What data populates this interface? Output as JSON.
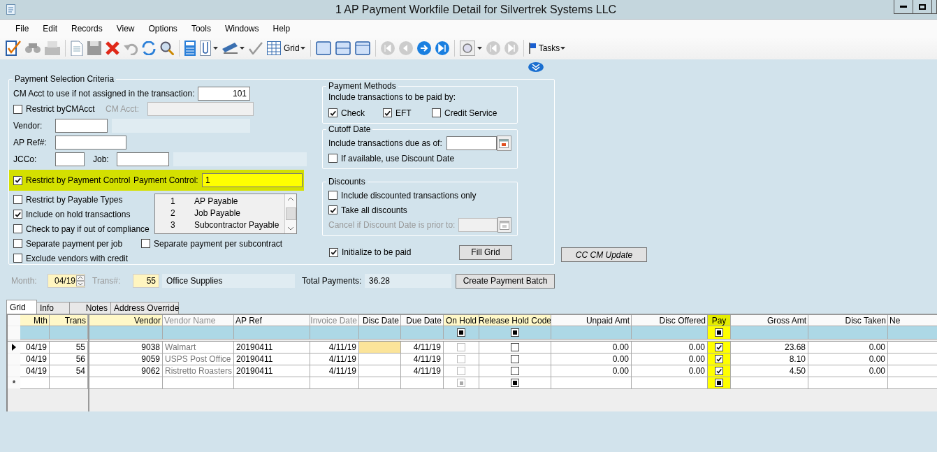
{
  "window": {
    "title": "1 AP Payment Workfile Detail for Silvertrek Systems LLC"
  },
  "menu": [
    "File",
    "Edit",
    "Records",
    "View",
    "Options",
    "Tools",
    "Windows",
    "Help"
  ],
  "toolbar": {
    "grid_label": "Grid",
    "tasks_label": "Tasks"
  },
  "selection_criteria": {
    "title": "Payment Selection Criteria",
    "cm_acct_label": "CM Acct to use if not assigned in the transaction:",
    "cm_acct_value": "101",
    "restrict_cmacct": {
      "label": "Restrict byCMAcct",
      "checked": false
    },
    "cm_acct_field_label": "CM Acct:",
    "vendor_label": "Vendor:",
    "ap_ref_label": "AP Ref#:",
    "jcco_label": "JCCo:",
    "job_label": "Job:",
    "restrict_payment_control": {
      "label": "Restrict by Payment Control",
      "checked": true,
      "highlighted": true
    },
    "payment_control_label": "Payment Control:",
    "payment_control_value": "1",
    "options": [
      {
        "label": "Restrict by Payable Types",
        "checked": false
      },
      {
        "label": "Include on hold transactions",
        "checked": true
      },
      {
        "label": "Check to pay if out of compliance",
        "checked": false
      },
      {
        "label": "Separate payment per job",
        "checked": false
      },
      {
        "label": "Exclude vendors with credit",
        "checked": false
      }
    ],
    "subcontract_option": {
      "label": "Separate payment per subcontract",
      "checked": false
    },
    "payable_types": [
      {
        "number": "1",
        "name": "AP Payable"
      },
      {
        "number": "2",
        "name": "Job Payable"
      },
      {
        "number": "3",
        "name": "Subcontractor Payable"
      }
    ],
    "payment_methods": {
      "title": "Payment Methods",
      "prompt": "Include transactions to be paid by:",
      "methods": [
        {
          "label": "Check",
          "checked": true
        },
        {
          "label": "EFT",
          "checked": true
        },
        {
          "label": "Credit Service",
          "checked": false
        }
      ]
    },
    "cutoff_date": {
      "title": "Cutoff Date",
      "due_label": "Include transactions due as of:",
      "use_discount_date": {
        "label": "If available, use Discount Date",
        "checked": false
      }
    },
    "discounts": {
      "title": "Discounts",
      "options": [
        {
          "label": "Include discounted transactions only",
          "checked": false
        },
        {
          "label": "Take all discounts",
          "checked": true
        }
      ],
      "cancel_label": "Cancel if Discount Date is prior to:"
    },
    "initialize_to_be_paid": {
      "label": "Initialize to be paid",
      "checked": true
    },
    "fill_grid_button": "Fill Grid"
  },
  "cc_cm_update_button": "CC CM Update",
  "batch": {
    "month_label": "Month:",
    "month_value": "04/19",
    "trans_label": "Trans#:",
    "trans_value": "55",
    "description": "Office Supplies",
    "total_label": "Total Payments:",
    "total_value": "36.28",
    "create_button": "Create Payment Batch"
  },
  "tabs": [
    {
      "label": "Grid",
      "selected": true
    },
    {
      "label": "Info",
      "selected": false
    },
    {
      "label": "Notes",
      "selected": false
    },
    {
      "label": "Address Override",
      "selected": false
    }
  ],
  "grid": {
    "frozen_columns": [
      {
        "label": "Mth",
        "kind": "key"
      },
      {
        "label": "Trans",
        "kind": "key"
      }
    ],
    "columns": [
      {
        "label": "Vendor",
        "kind": "key"
      },
      {
        "label": "Vendor Name",
        "kind": "readonly_text"
      },
      {
        "label": "AP Ref",
        "kind": "text"
      },
      {
        "label": "Invoice Date",
        "kind": "readonly_number"
      },
      {
        "label": "Disc Date",
        "kind": "number"
      },
      {
        "label": "Due Date",
        "kind": "number"
      },
      {
        "label": "On Hold",
        "kind": "key_check"
      },
      {
        "label": "Release Hold Code",
        "kind": "key_check"
      },
      {
        "label": "Unpaid Amt",
        "kind": "number"
      },
      {
        "label": "Disc Offered",
        "kind": "number"
      },
      {
        "label": "Pay",
        "kind": "check",
        "highlighted": true
      },
      {
        "label": "Gross Amt",
        "kind": "number"
      },
      {
        "label": "Disc Taken",
        "kind": "number"
      },
      {
        "label": "Ne",
        "kind": "text"
      }
    ],
    "filter_row": {
      "on_hold": {
        "mixed": true
      },
      "release_hold_code": {
        "mixed": true
      },
      "pay": {
        "mixed": true
      }
    },
    "rows": [
      {
        "current": true,
        "cells": {
          "mth": "04/19",
          "trans": "55",
          "vendor": "9038",
          "vendor_name": "Walmart",
          "ap_ref": "20190411",
          "invoice_date": "4/11/19",
          "disc_date": {
            "current": true
          },
          "due_date": "4/11/19",
          "on_hold": {
            "checked": false,
            "disabled": true
          },
          "release_hold_code": {
            "checked": false
          },
          "unpaid_amt": "0.00",
          "disc_offered": "0.00",
          "pay": {
            "checked": true
          },
          "gross_amt": "23.68",
          "disc_taken": "0.00"
        }
      },
      {
        "current": false,
        "cells": {
          "mth": "04/19",
          "trans": "56",
          "vendor": "9059",
          "vendor_name": "USPS Post Office",
          "ap_ref": "20190411",
          "invoice_date": "4/11/19",
          "due_date": "4/11/19",
          "on_hold": {
            "checked": false,
            "disabled": true
          },
          "release_hold_code": {
            "checked": false
          },
          "unpaid_amt": "0.00",
          "disc_offered": "0.00",
          "pay": {
            "checked": true
          },
          "gross_amt": "8.10",
          "disc_taken": "0.00"
        }
      },
      {
        "current": false,
        "cells": {
          "mth": "04/19",
          "trans": "54",
          "vendor": "9062",
          "vendor_name": "Ristretto Roasters",
          "ap_ref": "20190411",
          "invoice_date": "4/11/19",
          "due_date": "4/11/19",
          "on_hold": {
            "checked": false,
            "disabled": true
          },
          "release_hold_code": {
            "checked": false
          },
          "unpaid_amt": "0.00",
          "disc_offered": "0.00",
          "pay": {
            "checked": true
          },
          "gross_amt": "4.50",
          "disc_taken": "0.00"
        }
      },
      {
        "current": false,
        "marker": "*",
        "cells": {
          "on_hold": {
            "mixed": true,
            "disabled": true
          },
          "release_hold_code": {
            "mixed": true
          },
          "pay": {
            "mixed": true
          }
        }
      }
    ]
  }
}
